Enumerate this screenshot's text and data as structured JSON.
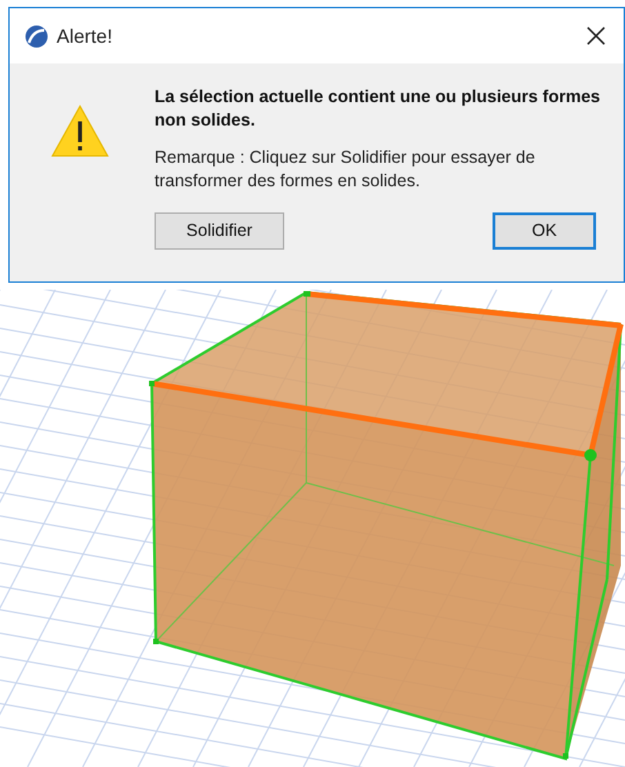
{
  "window": {
    "title": "Alerte!"
  },
  "message": "La sélection actuelle contient une ou plusieurs formes non solides.",
  "note": "Remarque : Cliquez sur Solidifier pour essayer de transformer des formes en solides.",
  "buttons": [
    {
      "label": "Solidifier",
      "default": false
    },
    {
      "label": "OK",
      "default": true
    }
  ]
}
